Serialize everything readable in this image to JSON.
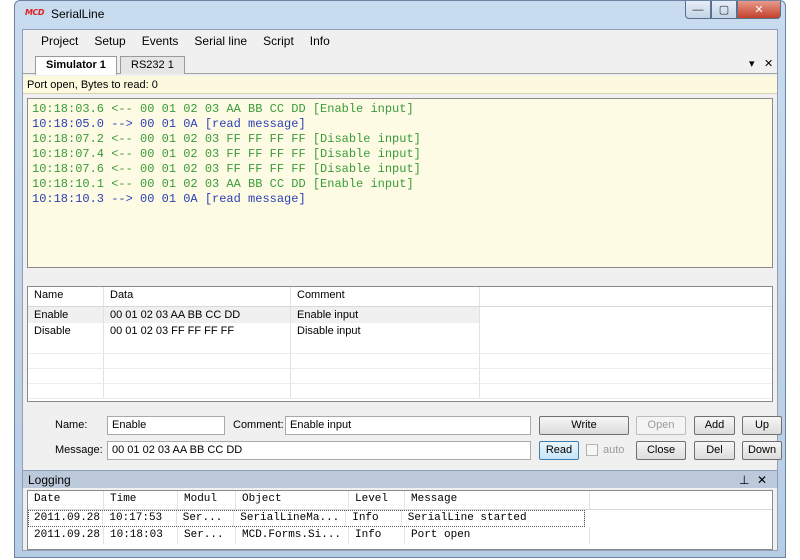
{
  "window": {
    "logo_text": "MCD",
    "title": "SerialLine",
    "minimize_glyph": "—",
    "maximize_glyph": "▢",
    "close_glyph": "✕"
  },
  "menu": [
    "Project",
    "Setup",
    "Events",
    "Serial line",
    "Script",
    "Info"
  ],
  "tabs": [
    {
      "label": "Simulator 1",
      "active": true
    },
    {
      "label": "RS232 1",
      "active": false
    }
  ],
  "tab_controls": {
    "dropdown": "▾",
    "close": "✕"
  },
  "status": "Port open, Bytes to read: 0",
  "log_lines": [
    {
      "text": "10:18:03.6 <-- 00 01 02 03 AA BB CC DD [Enable input]",
      "color": "#3a9b3a"
    },
    {
      "text": "10:18:05.0 --> 00 01 0A [read message]",
      "color": "#2b3fb5"
    },
    {
      "text": "10:18:07.2 <-- 00 01 02 03 FF FF FF FF [Disable input]",
      "color": "#3a9b3a"
    },
    {
      "text": "10:18:07.4 <-- 00 01 02 03 FF FF FF FF [Disable input]",
      "color": "#3a9b3a"
    },
    {
      "text": "10:18:07.6 <-- 00 01 02 03 FF FF FF FF [Disable input]",
      "color": "#3a9b3a"
    },
    {
      "text": "10:18:10.1 <-- 00 01 02 03 AA BB CC DD [Enable input]",
      "color": "#3a9b3a"
    },
    {
      "text": "10:18:10.3 --> 00 01 0A [read message]",
      "color": "#2b3fb5"
    }
  ],
  "messages": {
    "headers": [
      "Name",
      "Data",
      "Comment"
    ],
    "rows": [
      {
        "name": "Enable",
        "data": "00 01 02 03 AA BB CC DD",
        "comment": "Enable input",
        "selected": true
      },
      {
        "name": "Disable",
        "data": "00 01 02 03 FF FF FF FF",
        "comment": "Disable input",
        "selected": false
      }
    ]
  },
  "form": {
    "name_label": "Name:",
    "name_value": "Enable",
    "comment_label": "Comment:",
    "comment_value": "Enable input",
    "message_label": "Message:",
    "message_value": "00 01 02 03 AA BB CC DD",
    "auto_label": "auto",
    "auto_checked": false,
    "buttons": {
      "write": "Write",
      "open": "Open",
      "add": "Add",
      "up": "Up",
      "read": "Read",
      "close": "Close",
      "del": "Del",
      "down": "Down"
    }
  },
  "logging": {
    "title": "Logging",
    "pin_glyph": "⊥",
    "close_glyph": "✕",
    "headers": [
      "Date",
      "Time",
      "Modul",
      "Object",
      "Level",
      "Message"
    ],
    "rows": [
      {
        "date": "2011.09.28",
        "time": "10:17:53",
        "modul": "Ser...",
        "object": "SerialLineMa...",
        "level": "Info",
        "message": "SerialLine started"
      },
      {
        "date": "2011.09.28",
        "time": "10:18:03",
        "modul": "Ser...",
        "object": "MCD.Forms.Si...",
        "level": "Info",
        "message": "Port open"
      }
    ]
  }
}
